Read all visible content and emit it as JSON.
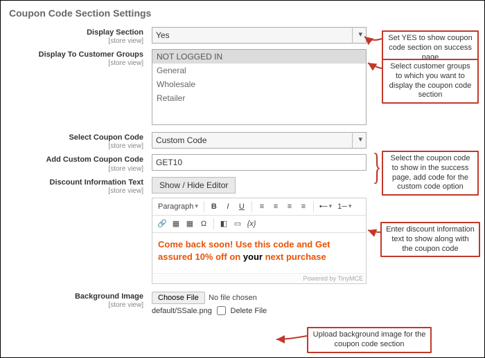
{
  "section_title": "Coupon Code Section Settings",
  "scope_label": "[store view]",
  "labels": {
    "display_section": "Display Section",
    "customer_groups": "Display To Customer Groups",
    "select_coupon": "Select Coupon Code",
    "add_custom": "Add Custom Coupon Code",
    "discount_info": "Discount Information Text",
    "bg_image": "Background Image"
  },
  "display_section": {
    "value": "Yes"
  },
  "customer_groups": {
    "options": [
      "NOT LOGGED IN",
      "General",
      "Wholesale",
      "Retailer"
    ],
    "selected": 0
  },
  "select_coupon": {
    "value": "Custom Code"
  },
  "add_custom": {
    "value": "GET10"
  },
  "editor": {
    "toggle_btn": "Show / Hide Editor",
    "para_label": "Paragraph",
    "content_prefix": "Come back soon! Use this code and Get assured 10% off on ",
    "content_bold": "your",
    "content_suffix": " next purchase",
    "powered": "Powered by TinyMCE"
  },
  "file": {
    "choose_btn": "Choose File",
    "no_file": "No file chosen",
    "current": "default/SSale.png",
    "delete_label": "Delete File"
  },
  "callouts": {
    "c1": "Set YES to show coupon code section on success page",
    "c2": "Select customer groups to which you want to display the coupon code section",
    "c3": "Select the coupon code to show in the success page, add code for the custom code option",
    "c4": "Enter discount information text to show along with the coupon code",
    "c5": "Upload background image for the coupon code section"
  }
}
